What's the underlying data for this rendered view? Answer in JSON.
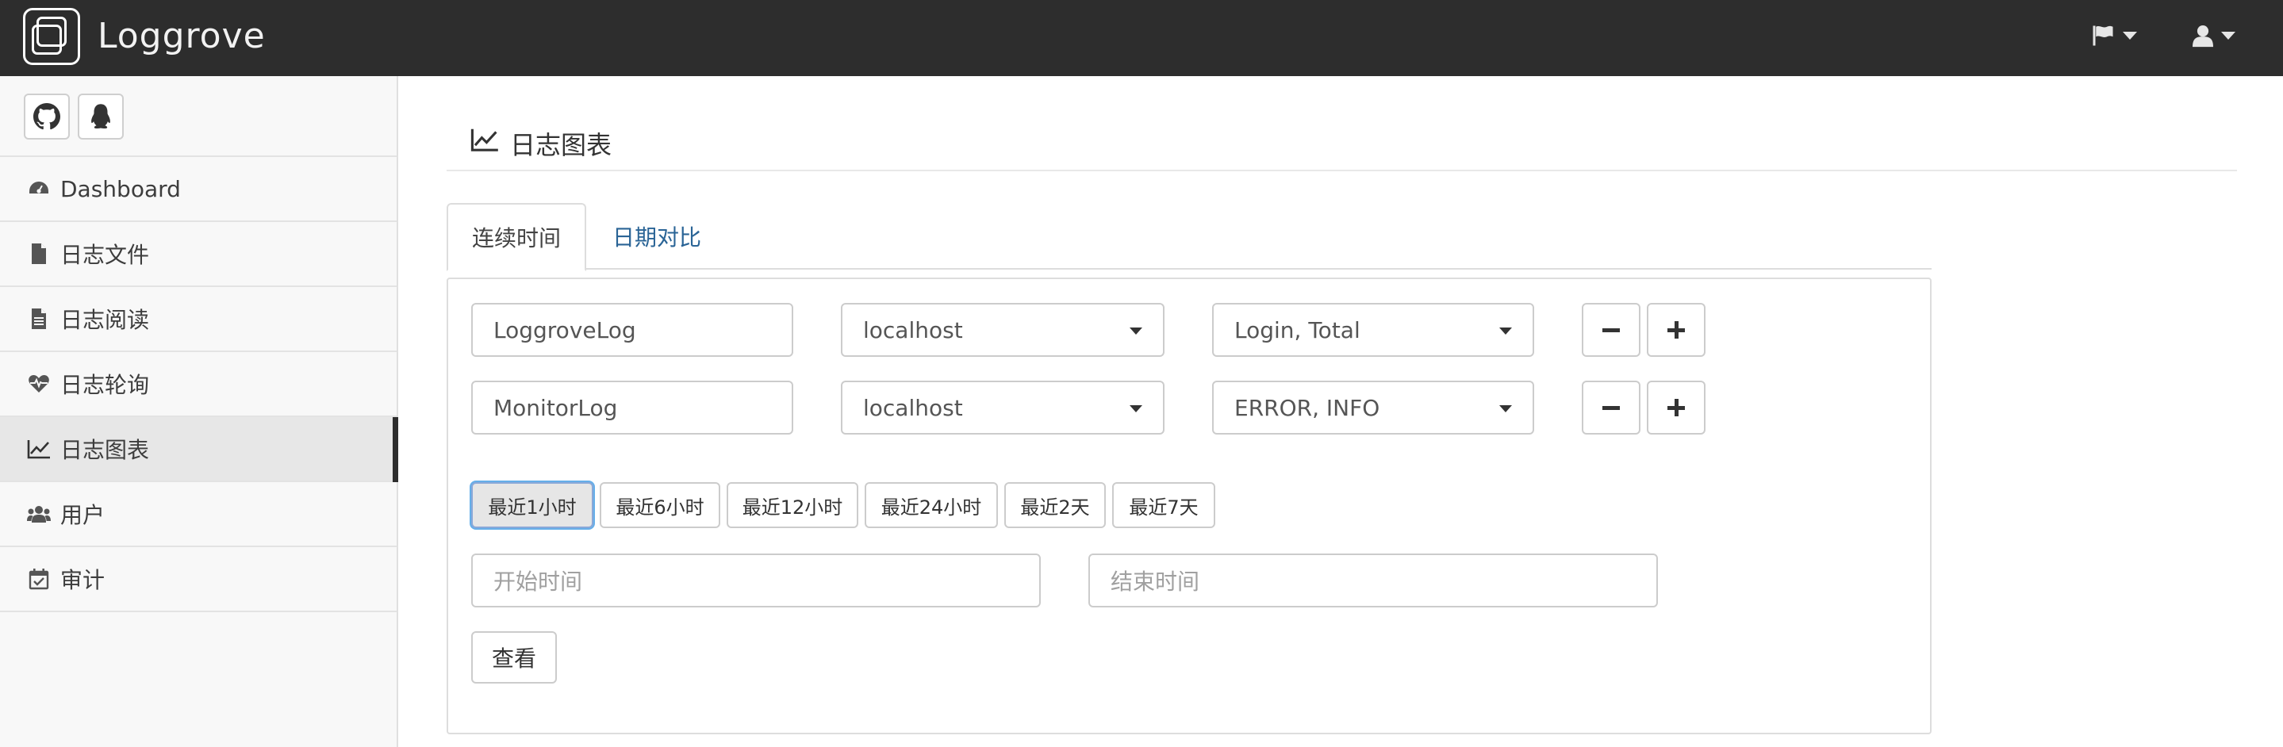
{
  "app": {
    "brand": "Loggrove",
    "nav_icons": [
      "flag-icon",
      "user-icon"
    ]
  },
  "sidebar": {
    "social": [
      "github-icon",
      "qq-icon"
    ],
    "items": [
      {
        "label": "Dashboard",
        "icon": "dashboard-icon"
      },
      {
        "label": "日志文件",
        "icon": "file-icon"
      },
      {
        "label": "日志阅读",
        "icon": "file-text-icon"
      },
      {
        "label": "日志轮询",
        "icon": "heartbeat-icon"
      },
      {
        "label": "日志图表",
        "icon": "line-chart-icon",
        "active": true
      },
      {
        "label": "用户",
        "icon": "users-icon"
      },
      {
        "label": "审计",
        "icon": "calendar-check-icon"
      }
    ]
  },
  "main": {
    "title": "日志图表",
    "tabs": [
      {
        "label": "连续时间",
        "active": true
      },
      {
        "label": "日期对比",
        "active": false
      }
    ],
    "rows": [
      {
        "logfile": "LoggroveLog",
        "host": "localhost",
        "monitors": "Login, Total"
      },
      {
        "logfile": "MonitorLog",
        "host": "localhost",
        "monitors": "ERROR, INFO"
      }
    ],
    "ranges": [
      {
        "label": "最近1小时",
        "active": true
      },
      {
        "label": "最近6小时"
      },
      {
        "label": "最近12小时"
      },
      {
        "label": "最近24小时"
      },
      {
        "label": "最近2天"
      },
      {
        "label": "最近7天"
      }
    ],
    "start_placeholder": "开始时间",
    "end_placeholder": "结束时间",
    "view_label": "查看"
  },
  "colors": {
    "navbar": "#2d2d2d",
    "sidebar_bg": "#f8f8f8",
    "link": "#2a6496",
    "active_focus": "#66afe9"
  }
}
